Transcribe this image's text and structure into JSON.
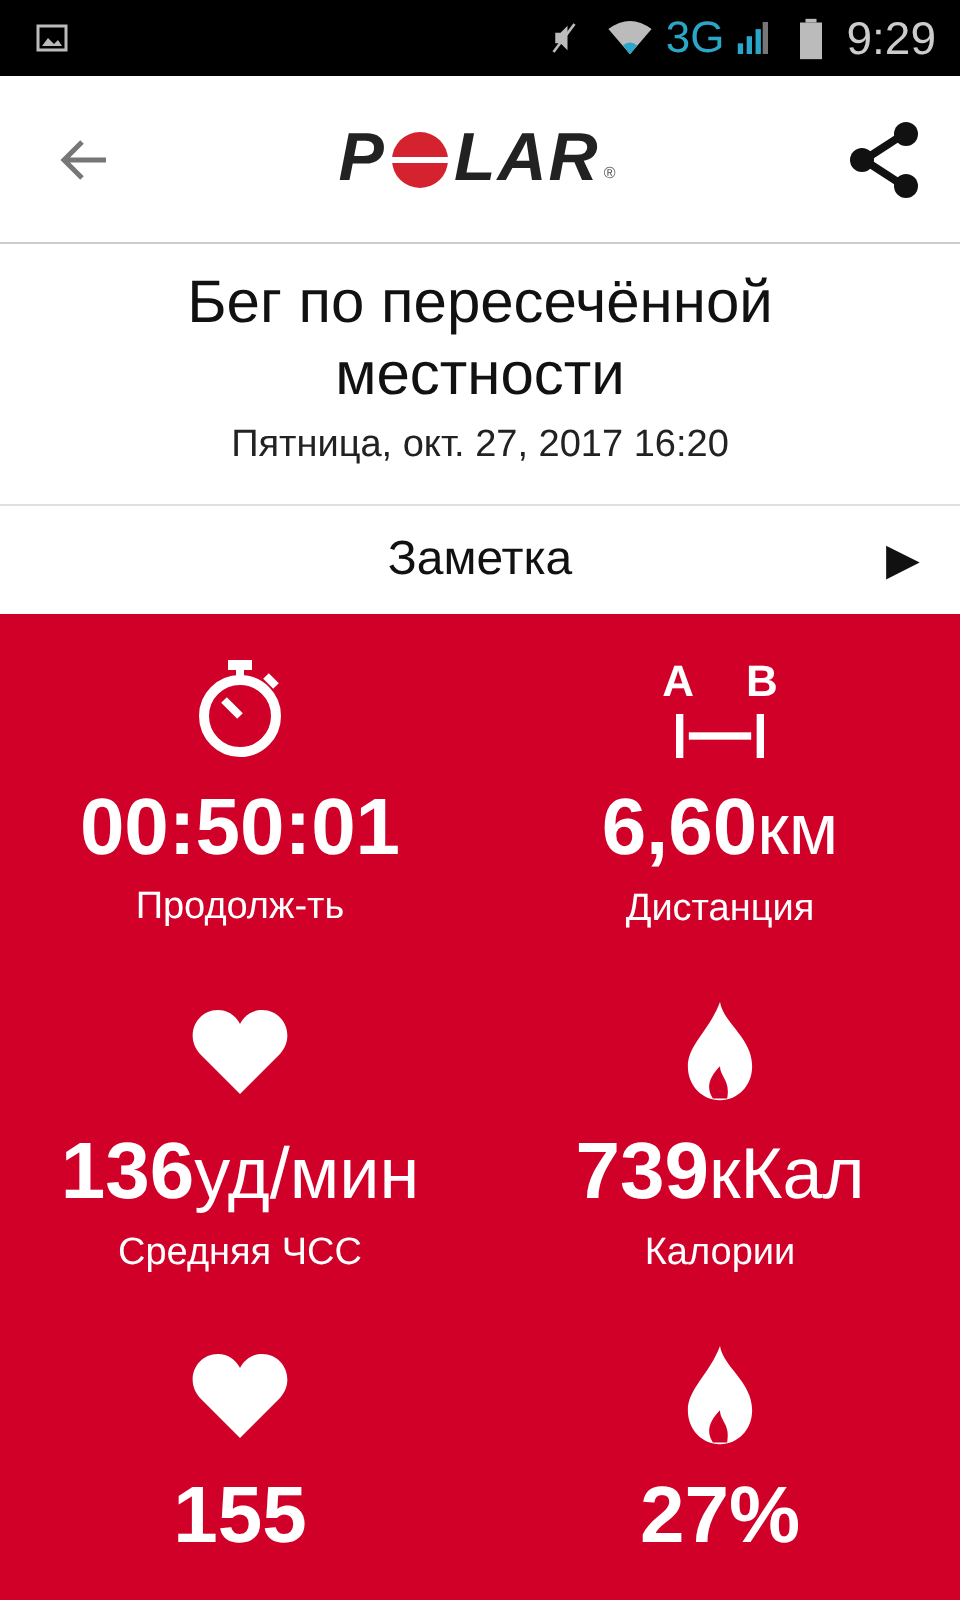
{
  "status_bar": {
    "network": "3G",
    "time": "9:29"
  },
  "header": {
    "logo": {
      "before": "P",
      "after": "LAR",
      "mark": "®"
    }
  },
  "activity": {
    "title": "Бег по пересечённой местности",
    "date": "Пятница, окт. 27, 2017 16:20"
  },
  "note": {
    "label": "Заметка",
    "arrow": "▶"
  },
  "distance_icon": {
    "labels": [
      "A",
      "B"
    ]
  },
  "metrics": [
    {
      "kind": "duration",
      "value": "00:50:01",
      "label": "Продолж-ть"
    },
    {
      "kind": "distance",
      "value": "6,60",
      "unit": "км",
      "label": "Дистанция"
    },
    {
      "kind": "heart",
      "value": "136",
      "unit": "уд/мин",
      "label": "Средняя ЧСС"
    },
    {
      "kind": "flame",
      "value": "739",
      "unit": "кКал",
      "label": "Калории"
    },
    {
      "kind": "heart",
      "value": "155"
    },
    {
      "kind": "flame",
      "value": "27%"
    }
  ]
}
